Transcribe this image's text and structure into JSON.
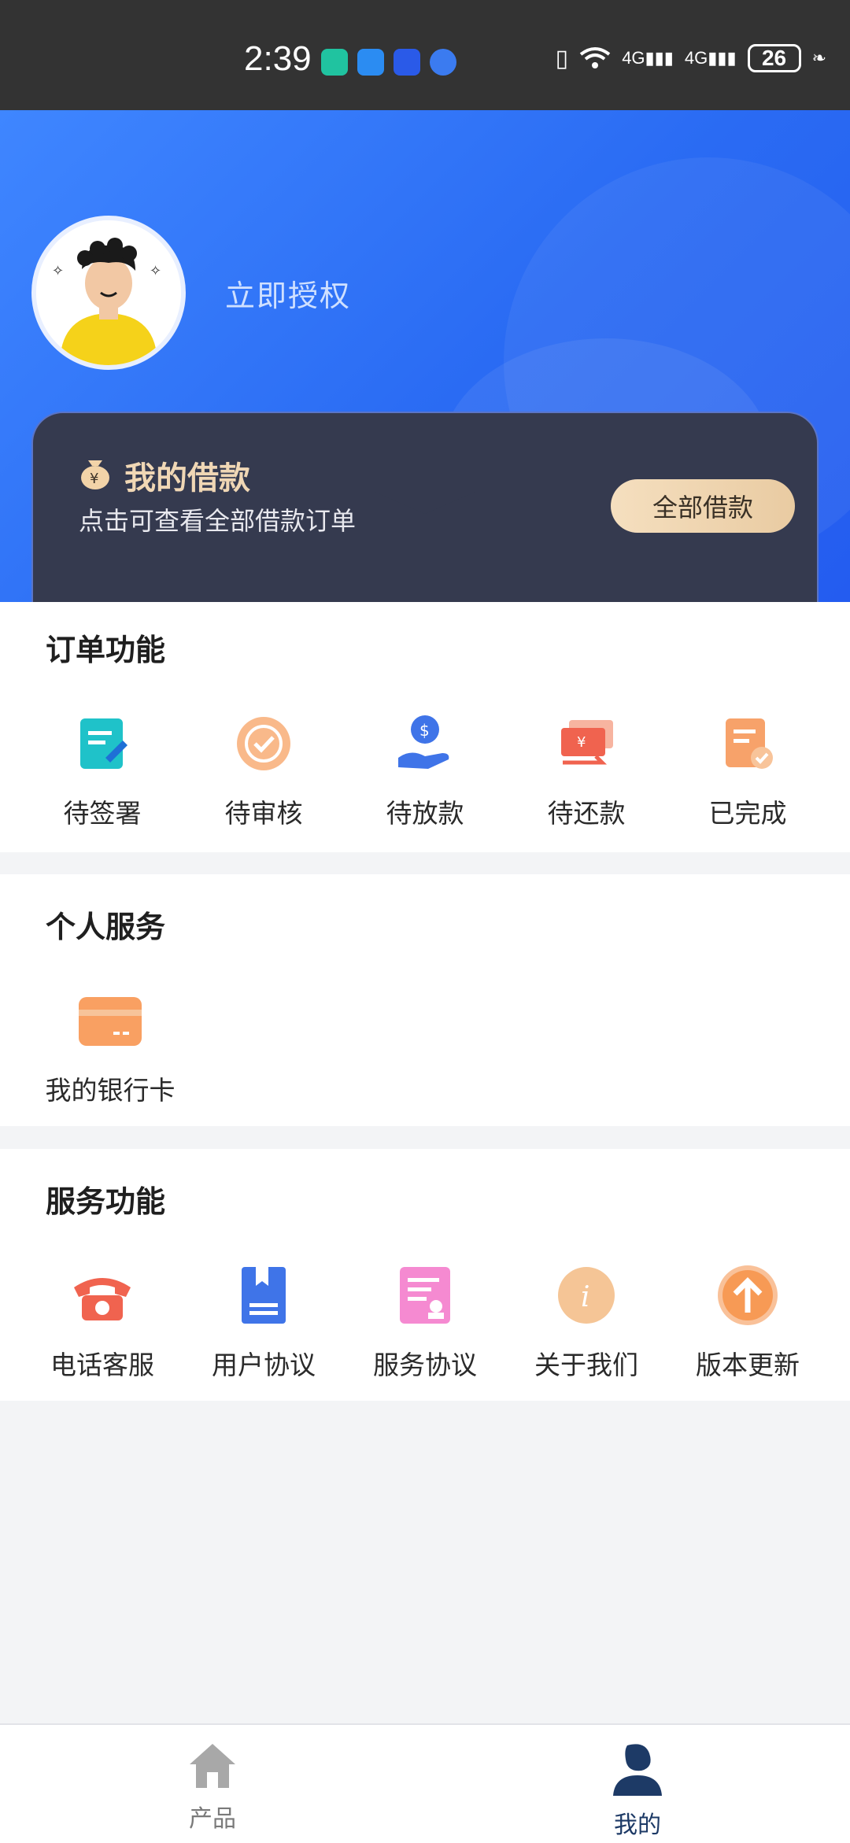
{
  "status_bar": {
    "time": "2:39",
    "network1": "4G",
    "network2": "4G",
    "battery": "26"
  },
  "header": {
    "auth_label": "立即授权"
  },
  "loan_card": {
    "title": "我的借款",
    "subtitle": "点击可查看全部借款订单",
    "button": "全部借款"
  },
  "order_section": {
    "title": "订单功能",
    "items": [
      {
        "label": "待签署",
        "icon": "sign-doc-icon"
      },
      {
        "label": "待审核",
        "icon": "review-check-icon"
      },
      {
        "label": "待放款",
        "icon": "money-hand-icon"
      },
      {
        "label": "待还款",
        "icon": "repay-icon"
      },
      {
        "label": "已完成",
        "icon": "completed-doc-icon"
      }
    ]
  },
  "personal_section": {
    "title": "个人服务",
    "items": [
      {
        "label": "我的银行卡",
        "icon": "bank-card-icon"
      }
    ]
  },
  "service_section": {
    "title": "服务功能",
    "items": [
      {
        "label": "电话客服",
        "icon": "phone-icon"
      },
      {
        "label": "用户协议",
        "icon": "user-agreement-icon"
      },
      {
        "label": "服务协议",
        "icon": "service-agreement-icon"
      },
      {
        "label": "关于我们",
        "icon": "info-icon"
      },
      {
        "label": "版本更新",
        "icon": "upload-arrow-icon"
      }
    ]
  },
  "bottom_nav": {
    "items": [
      {
        "label": "产品",
        "icon": "home-icon",
        "active": false
      },
      {
        "label": "我的",
        "icon": "profile-icon",
        "active": true
      }
    ]
  },
  "colors": {
    "header_blue": "#2a6bf3",
    "card_dark": "#353a4f",
    "gold_button": "#e9cba2",
    "nav_active": "#1d3a66",
    "nav_inactive": "#9a9a9a"
  }
}
